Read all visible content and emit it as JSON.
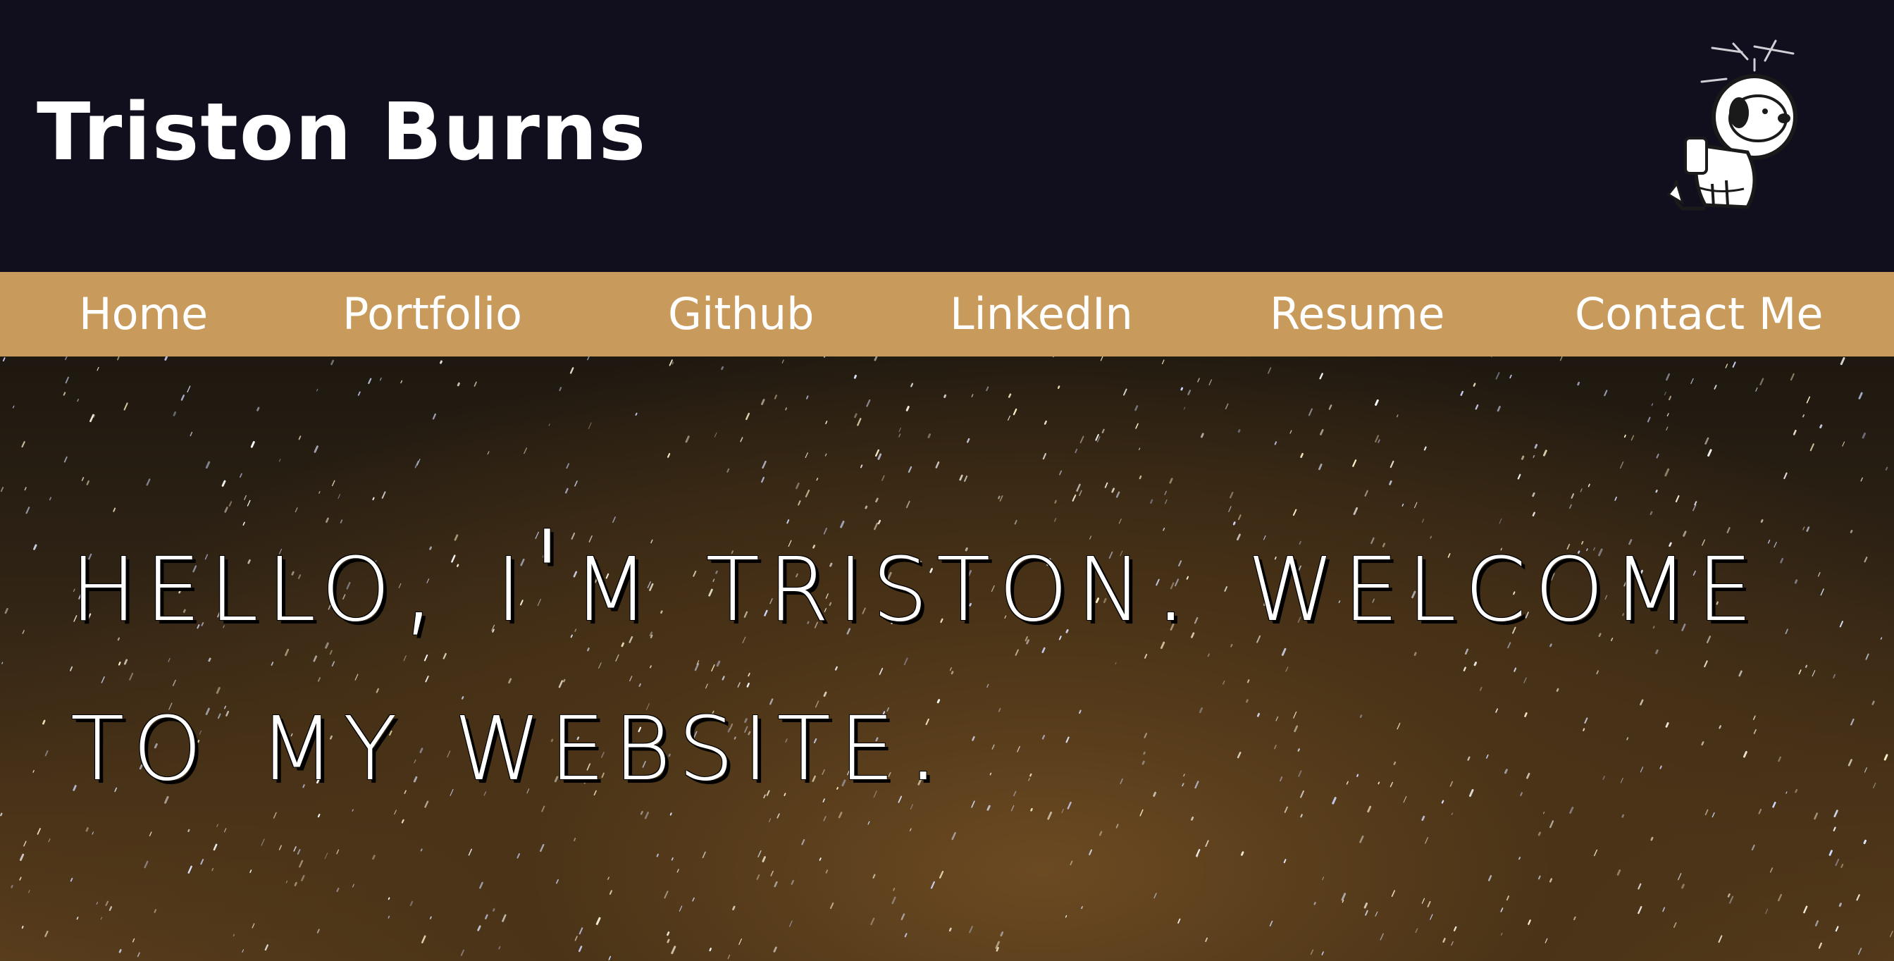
{
  "header": {
    "site_title": "Triston Burns",
    "logo_icon": "astronaut-dog-icon"
  },
  "nav": {
    "items": [
      {
        "label": "Home"
      },
      {
        "label": "Portfolio"
      },
      {
        "label": "Github"
      },
      {
        "label": "LinkedIn"
      },
      {
        "label": "Resume"
      },
      {
        "label": "Contact Me"
      }
    ]
  },
  "hero": {
    "headline": "Hello, I'm Triston. Welcome to my website."
  },
  "colors": {
    "header_bg": "#110e1d",
    "nav_bg": "#c89b5c",
    "text": "#ffffff"
  }
}
